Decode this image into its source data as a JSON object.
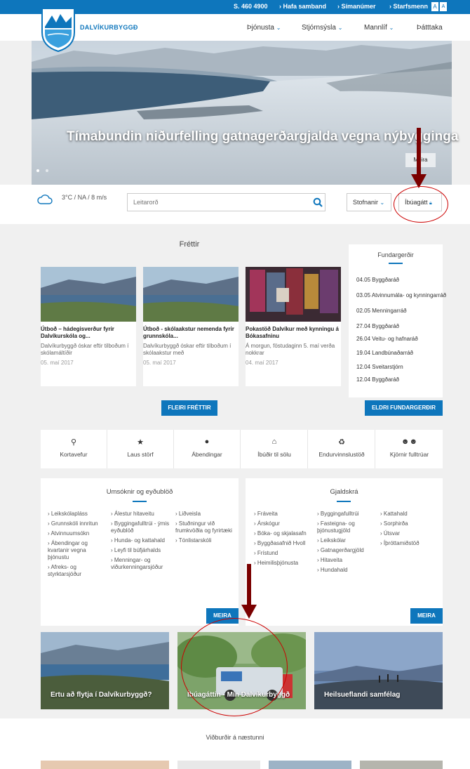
{
  "topbar": {
    "phone": "S. 460 4900",
    "links": [
      "› Hafa samband",
      "› Símanúmer",
      "› Starfsmenn"
    ],
    "font_small": "A",
    "font_large": "A"
  },
  "header": {
    "brand": "DALVÍKURBYGGÐ",
    "nav": [
      "Þjónusta",
      "Stjórnsýsla",
      "Mannlíf",
      "Þátttaka"
    ]
  },
  "hero": {
    "title": "Tímabundin niðurfelling gatnagerðargjalda vegna nýbygginga",
    "button": "Meira"
  },
  "search": {
    "weather": "3°C / NA / 8 m/s",
    "placeholder": "Leitarorð",
    "stofnanir": "Stofnanir",
    "ibuagatt": "Íbúagátt"
  },
  "news": {
    "title": "Fréttir",
    "items": [
      {
        "title": "Útboð – hádegisverður fyrir Dalvíkurskóla og...",
        "body": "Dalvíkurbyggð óskar eftir tilboðum í skólamáltíðir",
        "date": "05. maí 2017"
      },
      {
        "title": "Útboð - skólaakstur nemenda fyrir grunnskóla...",
        "body": "Dalvíkurbyggð óskar eftir tilboðum í skólaakstur með",
        "date": "05. maí 2017"
      },
      {
        "title": "Pokastöð Dalvíkur með kynningu á Bókasafninu",
        "body": "Á morgun, föstudaginn 5. maí verða nokkrar",
        "date": "04. maí 2017"
      }
    ],
    "more": "FLEIRI FRÉTTIR"
  },
  "meetings": {
    "title": "Fundargerðir",
    "rows": [
      {
        "date": "04.05",
        "name": "Byggðaráð"
      },
      {
        "date": "03.05",
        "name": "Atvinnumála- og kynningarráð"
      },
      {
        "date": "02.05",
        "name": "Menningarráð"
      },
      {
        "date": "27.04",
        "name": "Byggðaráð"
      },
      {
        "date": "26.04",
        "name": "Veitu- og hafnaráð"
      },
      {
        "date": "19.04",
        "name": "Landbúnaðarráð"
      },
      {
        "date": "12.04",
        "name": "Sveitarstjórn"
      },
      {
        "date": "12.04",
        "name": "Byggðaráð"
      }
    ],
    "more": "ELDRI FUNDARGERÐIR"
  },
  "quicklinks": [
    {
      "icon": "map-pin-icon",
      "label": "Kortavefur"
    },
    {
      "icon": "star-icon",
      "label": "Laus störf"
    },
    {
      "icon": "speech-bubble-icon",
      "label": "Ábendingar"
    },
    {
      "icon": "house-icon",
      "label": "Íbúðir til sölu"
    },
    {
      "icon": "recycle-icon",
      "label": "Endurvinnslustöð"
    },
    {
      "icon": "people-icon",
      "label": "Kjörnir fulltrúar"
    }
  ],
  "forms": {
    "title": "Umsóknir og eyðublöð",
    "col1": [
      "› Leikskólapláss",
      "› Grunnskóli innritun",
      "› Atvinnuumsókn",
      "› Ábendingar og kvartanir vegna þjónustu",
      "› Afreks- og styrktarsjóður"
    ],
    "col2": [
      "› Álestur hitaveitu",
      "› Byggingafulltrúi - ýmis eyðublöð",
      "› Hunda- og kattahald",
      "› Leyfi til búfjárhalds",
      "› Menningar- og viðurkenningarsjóður"
    ],
    "col3": [
      "› Liðveisla",
      "› Stuðningur við frumkvöðla og fyrirtæki",
      "› Tónlistarskóli"
    ],
    "more": "MEIRA"
  },
  "fees": {
    "title": "Gjaldskrá",
    "col1": [
      "› Fráveita",
      "› Árskógur",
      "› Bóka- og skjalasafn",
      "› Byggðasafnið Hvoll",
      "› Frístund",
      "› Heimilisþjónusta"
    ],
    "col2": [
      "› Byggingafulltrúi",
      "› Fasteigna- og þjónustugjöld",
      "› Leikskólar",
      "› Gatnagerðargjöld",
      "› Hitaveita",
      "› Hundahald"
    ],
    "col3": [
      "› Kattahald",
      "› Sorphirða",
      "› Útsvar",
      "› Íþróttamiðstöð"
    ],
    "more": "MEIRA"
  },
  "tiles": [
    {
      "label": "Ertu að flytja í Dalvíkurbyggð?"
    },
    {
      "label": "Íbúagáttin - Mín Dalvíkurbyggð"
    },
    {
      "label": "Heilsueflandi samfélag"
    }
  ],
  "events": {
    "title": "Viðburðir á næstunni"
  },
  "colors": {
    "brand_blue": "#0e76bc",
    "annotation_red": "#cc0000",
    "annotation_arrow": "#7a0000"
  }
}
